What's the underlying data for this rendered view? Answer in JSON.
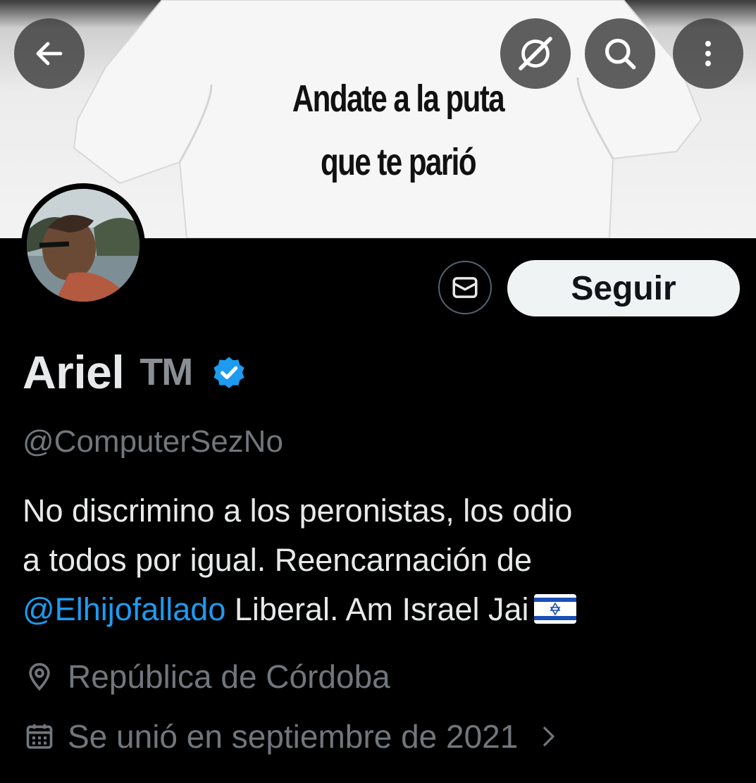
{
  "banner": {
    "shirt_line1": "Andate a la puta",
    "shirt_line2": "que te parió"
  },
  "toolbar": {
    "back_icon": "arrow-left-icon",
    "grok_icon": "grok-icon",
    "search_icon": "search-icon",
    "more_icon": "more-vertical-icon"
  },
  "profile": {
    "name": "Ariel",
    "name_suffix": "TM",
    "handle": "@ComputerSezNo",
    "bio_line1": "No discrimino a los peronistas, los odio",
    "bio_line2": "a todos por igual. Reencarnación de",
    "bio_mention": "@Elhijofallado",
    "bio_line3_rest": " Liberal. Am Israel Jai",
    "location": "República de Córdoba",
    "joined": "Se unió en septiembre de 2021"
  },
  "actions": {
    "follow_label": "Seguir",
    "message_icon": "mail-icon"
  },
  "colors": {
    "background": "#000000",
    "text": "#e7e9ea",
    "secondary": "#71767b",
    "accent": "#1d9bf0",
    "follow_bg": "#eff3f4"
  }
}
